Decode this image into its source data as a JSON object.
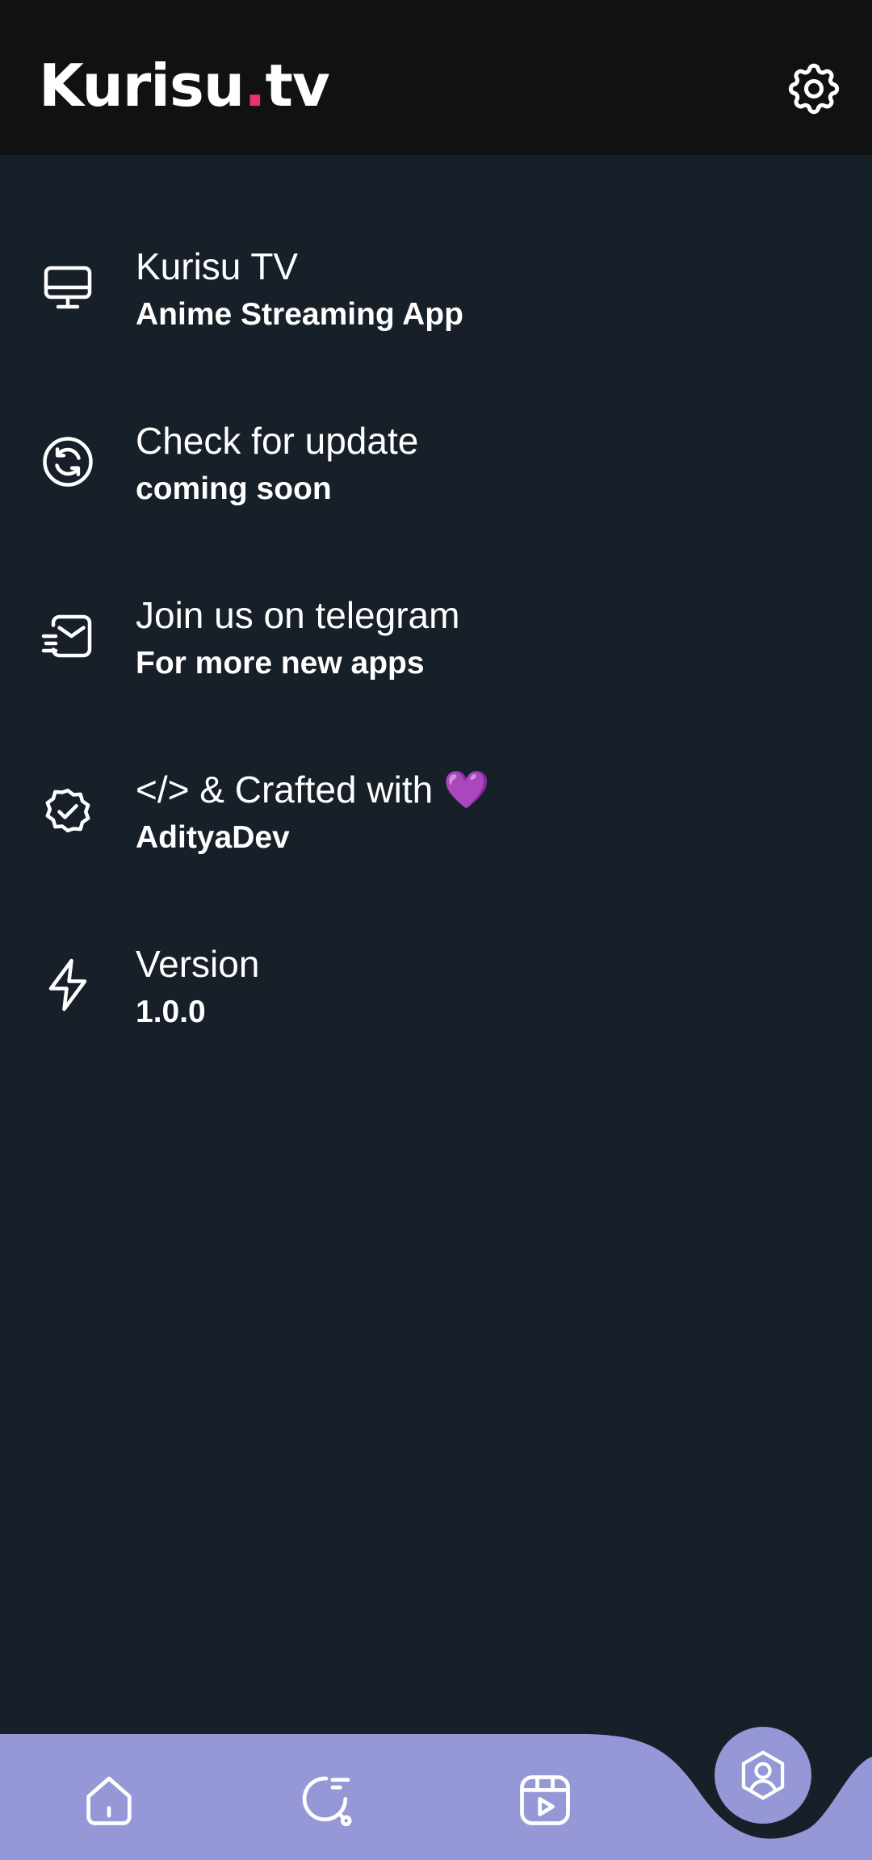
{
  "header": {
    "logo_main": "Kurisu",
    "logo_dot": ".",
    "logo_suffix": "tv",
    "settings_icon": "gear-icon"
  },
  "about_items": [
    {
      "icon": "monitor-icon",
      "title": "Kurisu TV",
      "subtitle": "Anime Streaming App"
    },
    {
      "icon": "refresh-icon",
      "title": "Check for update",
      "subtitle": "coming soon"
    },
    {
      "icon": "mail-send-icon",
      "title": "Join us on telegram",
      "subtitle": "For more new apps"
    },
    {
      "icon": "verified-badge-icon",
      "title": "</> & Crafted with 💜",
      "subtitle": "AdityaDev"
    },
    {
      "icon": "lightning-icon",
      "title": "Version",
      "subtitle": "1.0.0"
    }
  ],
  "bottom_nav": {
    "items": [
      {
        "icon": "home-icon",
        "active": false
      },
      {
        "icon": "search-icon",
        "active": false
      },
      {
        "icon": "video-reel-icon",
        "active": false
      },
      {
        "icon": "profile-icon",
        "active": true
      }
    ]
  },
  "colors": {
    "background": "#171f29",
    "header": "#111111",
    "accent_dot": "#e8336e",
    "nav_bar": "#9597d6",
    "text": "#ffffff"
  }
}
